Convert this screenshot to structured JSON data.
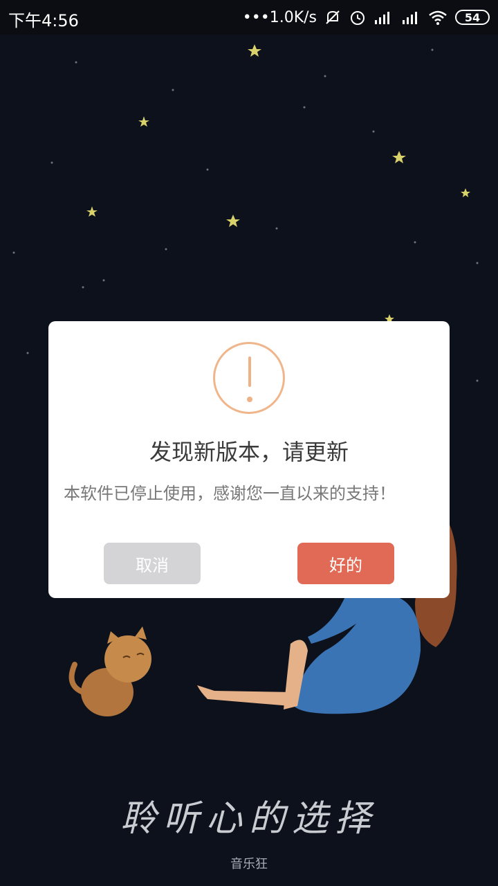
{
  "status_bar": {
    "time": "下午4:56",
    "network_speed": "•••1.0K/s",
    "battery": "54"
  },
  "dialog": {
    "title": "发现新版本，请更新",
    "message": "本软件已停止使用，感谢您一直以来的支持！",
    "cancel_label": "取消",
    "ok_label": "好的",
    "ok_color": "#e06a55",
    "cancel_color": "#d4d4d6",
    "icon": "alert-circle-icon"
  },
  "splash": {
    "slogan": "聆听心的选择",
    "app_name": "音乐狂"
  }
}
